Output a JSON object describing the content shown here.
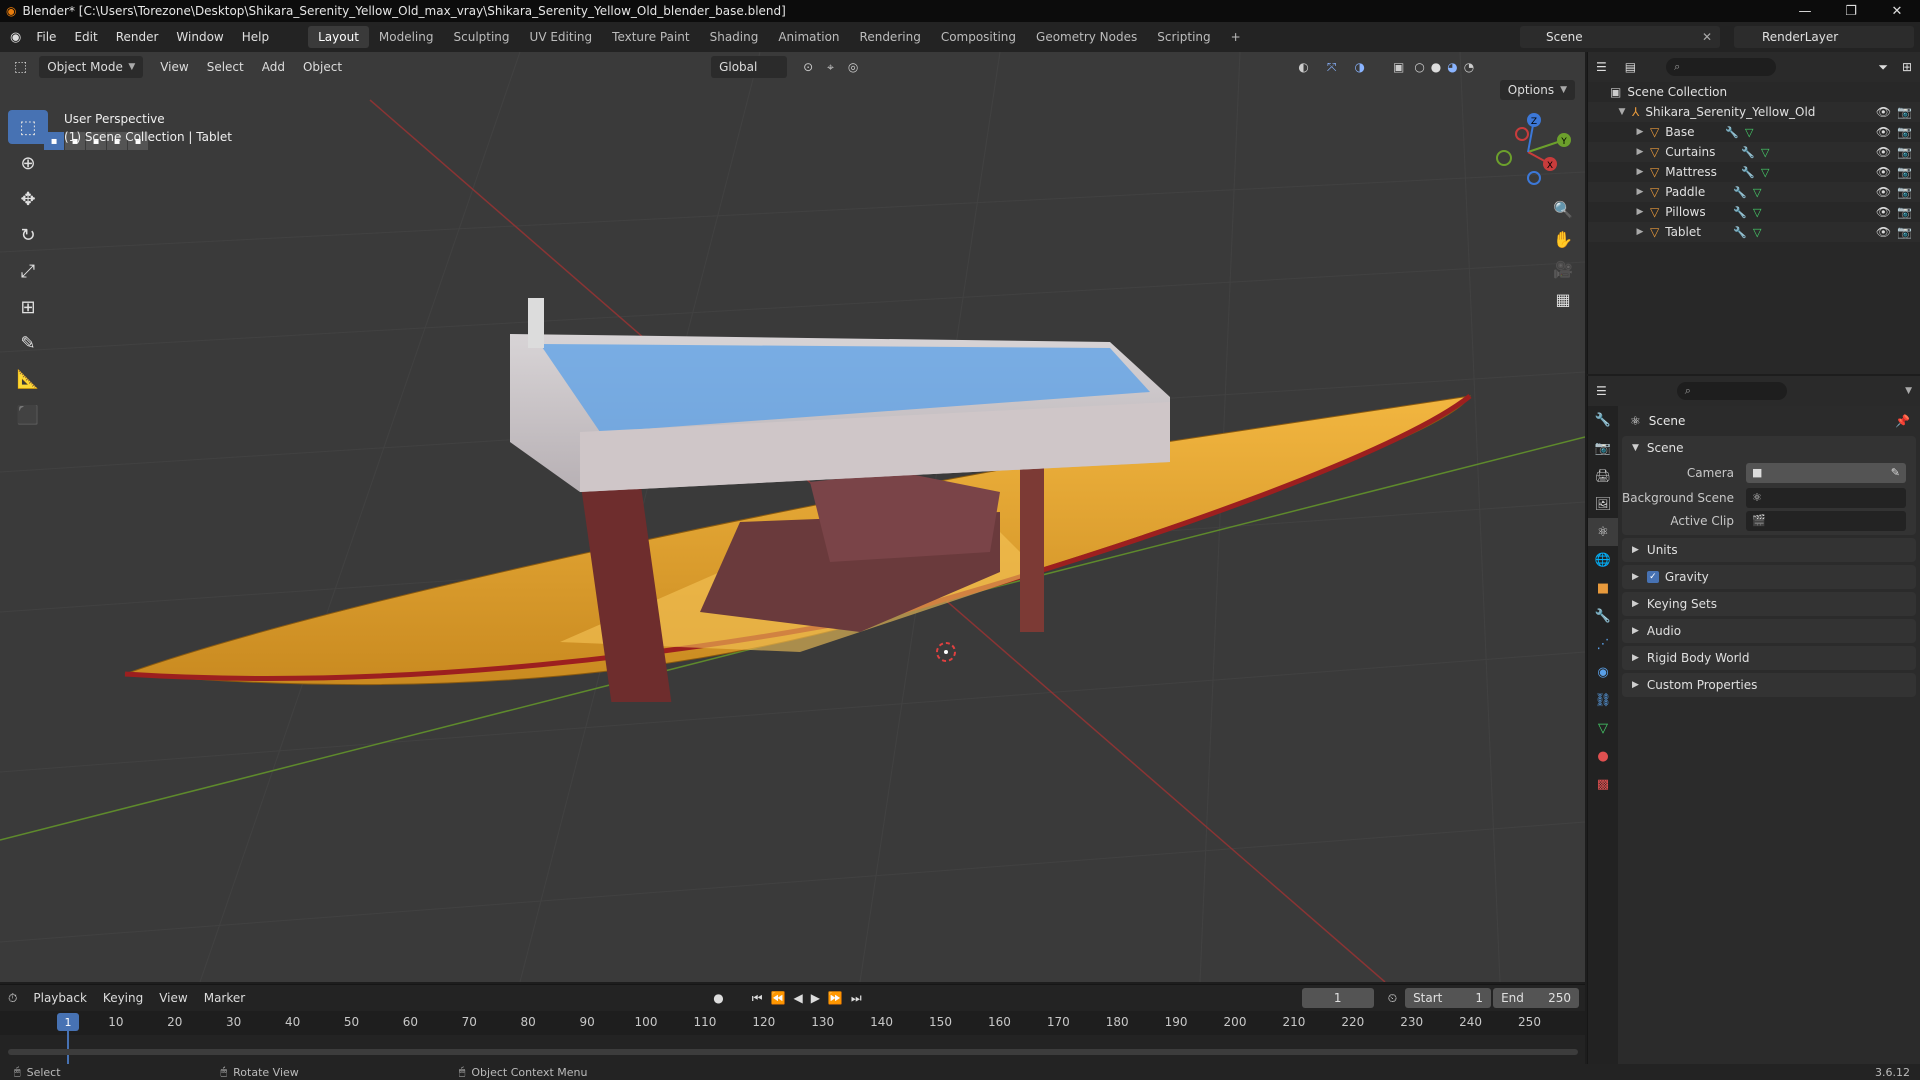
{
  "window": {
    "title": "Blender* [C:\\Users\\Torezone\\Desktop\\Shikara_Serenity_Yellow_Old_max_vray\\Shikara_Serenity_Yellow_Old_blender_base.blend]",
    "minimize": "—",
    "maximize": "❐",
    "close": "✕"
  },
  "menu": [
    "File",
    "Edit",
    "Render",
    "Window",
    "Help"
  ],
  "workspaces": [
    "Layout",
    "Modeling",
    "Sculpting",
    "UV Editing",
    "Texture Paint",
    "Shading",
    "Animation",
    "Rendering",
    "Compositing",
    "Geometry Nodes",
    "Scripting",
    "+"
  ],
  "active_workspace": "Layout",
  "scene_name": "Scene",
  "render_layer": "RenderLayer",
  "viewport": {
    "mode": "Object Mode",
    "menus": [
      "View",
      "Select",
      "Add",
      "Object"
    ],
    "transform_orientation": "Global",
    "options_label": "Options",
    "info_line1": "User Perspective",
    "info_line2": "(1) Scene Collection | Tablet",
    "gizmo_axes": {
      "x": "X",
      "y": "Y",
      "z": "Z"
    }
  },
  "outliner": {
    "root": "Scene Collection",
    "collection": "Shikara_Serenity_Yellow_Old",
    "objects": [
      "Base",
      "Curtains",
      "Mattress",
      "Paddle",
      "Pillows",
      "Tablet"
    ],
    "search_placeholder": "⌕"
  },
  "properties": {
    "context_title": "Scene",
    "scene_panel": "Scene",
    "camera_label": "Camera",
    "background_scene_label": "Background Scene",
    "active_clip_label": "Active Clip",
    "collapsed_panels": [
      "Units",
      "Gravity",
      "Keying Sets",
      "Audio",
      "Rigid Body World",
      "Custom Properties"
    ],
    "gravity_checked": true
  },
  "timeline": {
    "menus": [
      "Playback",
      "Keying",
      "View",
      "Marker"
    ],
    "current_frame": "1",
    "start_label": "Start",
    "start_value": "1",
    "end_label": "End",
    "end_value": "250",
    "ruler_ticks": [
      "1",
      "10",
      "20",
      "30",
      "40",
      "50",
      "60",
      "70",
      "80",
      "90",
      "100",
      "110",
      "120",
      "130",
      "140",
      "150",
      "160",
      "170",
      "180",
      "190",
      "200",
      "210",
      "220",
      "230",
      "240",
      "250"
    ]
  },
  "statusbar": {
    "select": "Select",
    "rotate": "Rotate View",
    "context_menu": "Object Context Menu",
    "version": "3.6.12"
  },
  "colors": {
    "accent": "#4772b3",
    "mesh_orange": "#e89a3c",
    "hull_yellow": "#e8a837",
    "x_axis": "#c83c3c",
    "y_axis": "#6ca02c",
    "z_axis": "#3c78d8"
  }
}
